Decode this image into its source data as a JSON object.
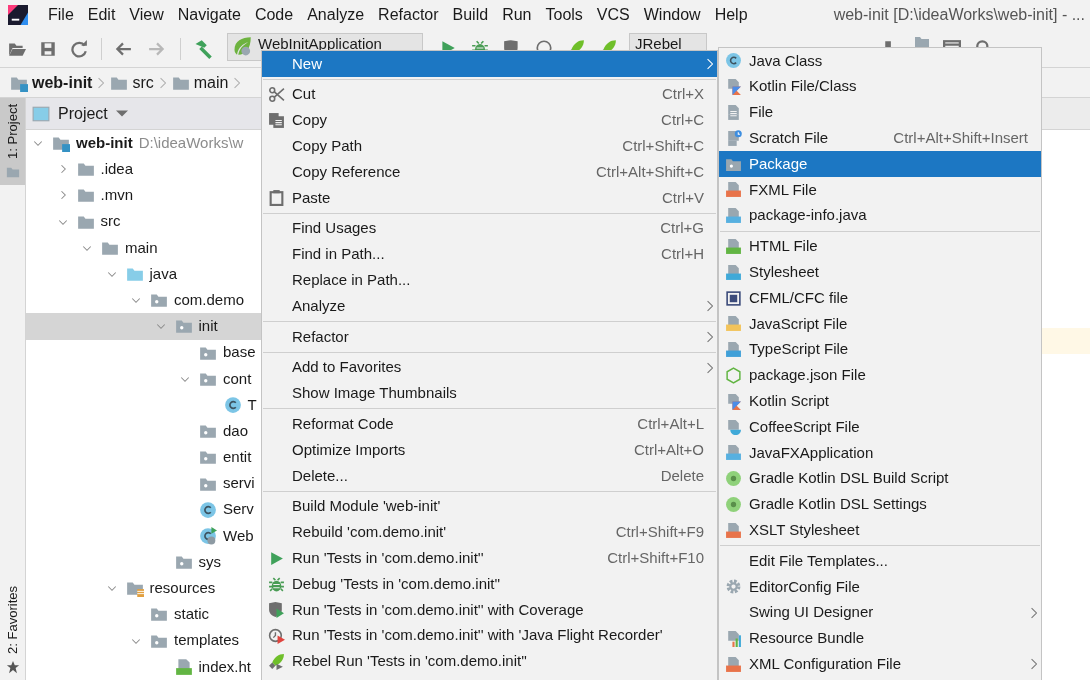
{
  "window": {
    "title": "web-init [D:\\ideaWorks\\web-init] - ..."
  },
  "menu_bar": [
    "File",
    "Edit",
    "View",
    "Navigate",
    "Code",
    "Analyze",
    "Refactor",
    "Build",
    "Run",
    "Tools",
    "VCS",
    "Window",
    "Help"
  ],
  "toolbar": {
    "run_configuration": "WebInitApplication",
    "jrebel_configuration": "JRebel"
  },
  "breadcrumbs": [
    "web-init",
    "src",
    "main"
  ],
  "tool_window_stripe": [
    {
      "label": "1: Project",
      "selected": true
    },
    {
      "label": "2: Favorites",
      "selected": false
    }
  ],
  "project_panel": {
    "title": "Project",
    "tree": [
      {
        "label": "web-init",
        "secondary": "D:\\ideaWorks\\w",
        "kind": "module",
        "expanded": true,
        "selected": false,
        "children": [
          {
            "label": ".idea",
            "kind": "folder",
            "expanded": false,
            "selected": false
          },
          {
            "label": ".mvn",
            "kind": "folder",
            "expanded": false,
            "selected": false
          },
          {
            "label": "src",
            "kind": "folder",
            "expanded": true,
            "selected": false,
            "children": [
              {
                "label": "main",
                "kind": "folder",
                "expanded": true,
                "selected": false,
                "children": [
                  {
                    "label": "java",
                    "kind": "source",
                    "expanded": true,
                    "selected": false,
                    "children": [
                      {
                        "label": "com.demo",
                        "kind": "package",
                        "expanded": true,
                        "selected": false,
                        "children": [
                          {
                            "label": "init",
                            "kind": "package",
                            "expanded": true,
                            "selected": true,
                            "children": [
                              {
                                "label": "base",
                                "kind": "package",
                                "selected": false
                              },
                              {
                                "label": "cont",
                                "kind": "package",
                                "expanded": true,
                                "selected": false,
                                "children": [
                                  {
                                    "label": "T",
                                    "kind": "class",
                                    "selected": false
                                  }
                                ]
                              },
                              {
                                "label": "dao",
                                "kind": "package",
                                "selected": false
                              },
                              {
                                "label": "entit",
                                "kind": "package",
                                "selected": false
                              },
                              {
                                "label": "servi",
                                "kind": "package",
                                "selected": false
                              },
                              {
                                "label": "Serv",
                                "kind": "class",
                                "selected": false
                              },
                              {
                                "label": "Web",
                                "kind": "spring-class",
                                "selected": false
                              }
                            ]
                          },
                          {
                            "label": "sys",
                            "kind": "package",
                            "selected": false
                          }
                        ]
                      }
                    ]
                  },
                  {
                    "label": "resources",
                    "kind": "resources",
                    "expanded": true,
                    "selected": false,
                    "children": [
                      {
                        "label": "static",
                        "kind": "package",
                        "selected": false
                      },
                      {
                        "label": "templates",
                        "kind": "package",
                        "expanded": true,
                        "selected": false,
                        "children": [
                          {
                            "label": "index.ht",
                            "kind": "html",
                            "selected": false
                          }
                        ]
                      }
                    ]
                  }
                ]
              }
            ]
          }
        ]
      }
    ]
  },
  "context_menu": {
    "items": [
      {
        "kind": "plain",
        "label": "New",
        "selected": true,
        "submenu": true
      },
      {
        "kind": "separator"
      },
      {
        "kind": "cut",
        "label": "Cut",
        "shortcut": "Ctrl+X",
        "selected": false
      },
      {
        "kind": "copy",
        "label": "Copy",
        "shortcut": "Ctrl+C",
        "selected": false
      },
      {
        "kind": "plain",
        "label": "Copy Path",
        "shortcut": "Ctrl+Shift+C",
        "selected": false
      },
      {
        "kind": "plain",
        "label": "Copy Reference",
        "shortcut": "Ctrl+Alt+Shift+C",
        "selected": false
      },
      {
        "kind": "paste",
        "label": "Paste",
        "shortcut": "Ctrl+V",
        "selected": false
      },
      {
        "kind": "separator"
      },
      {
        "kind": "plain",
        "label": "Find Usages",
        "shortcut": "Ctrl+G",
        "selected": false
      },
      {
        "kind": "plain",
        "label": "Find in Path...",
        "shortcut": "Ctrl+H",
        "selected": false
      },
      {
        "kind": "plain",
        "label": "Replace in Path...",
        "selected": false
      },
      {
        "kind": "plain",
        "label": "Analyze",
        "submenu": true,
        "selected": false
      },
      {
        "kind": "separator"
      },
      {
        "kind": "plain",
        "label": "Refactor",
        "submenu": true,
        "selected": false
      },
      {
        "kind": "separator"
      },
      {
        "kind": "plain",
        "label": "Add to Favorites",
        "submenu": true,
        "selected": false
      },
      {
        "kind": "plain",
        "label": "Show Image Thumbnails",
        "selected": false
      },
      {
        "kind": "separator"
      },
      {
        "kind": "plain",
        "label": "Reformat Code",
        "shortcut": "Ctrl+Alt+L",
        "selected": false
      },
      {
        "kind": "plain",
        "label": "Optimize Imports",
        "shortcut": "Ctrl+Alt+O",
        "selected": false
      },
      {
        "kind": "plain",
        "label": "Delete...",
        "shortcut": "Delete",
        "selected": false
      },
      {
        "kind": "separator"
      },
      {
        "kind": "plain",
        "label": "Build Module 'web-init'",
        "selected": false
      },
      {
        "kind": "plain",
        "label": "Rebuild 'com.demo.init'",
        "shortcut": "Ctrl+Shift+F9",
        "selected": false
      },
      {
        "kind": "run",
        "label": "Run 'Tests in 'com.demo.init''",
        "shortcut": "Ctrl+Shift+F10",
        "selected": false
      },
      {
        "kind": "debug",
        "label": "Debug 'Tests in 'com.demo.init''",
        "selected": false
      },
      {
        "kind": "coverage",
        "label": "Run 'Tests in 'com.demo.init'' with Coverage",
        "selected": false
      },
      {
        "kind": "profiler",
        "label": "Run 'Tests in 'com.demo.init'' with 'Java Flight Recorder'",
        "selected": false
      },
      {
        "kind": "rebel",
        "label": "Rebel Run 'Tests in 'com.demo.init''",
        "selected": false
      }
    ]
  },
  "new_submenu": {
    "items": [
      {
        "kind": "class",
        "label": "Java Class",
        "selected": false
      },
      {
        "kind": "kotlin",
        "label": "Kotlin File/Class",
        "selected": false
      },
      {
        "kind": "file",
        "label": "File",
        "selected": false
      },
      {
        "kind": "scratch",
        "label": "Scratch File",
        "shortcut": "Ctrl+Alt+Shift+Insert",
        "selected": false
      },
      {
        "kind": "package",
        "label": "Package",
        "selected": true
      },
      {
        "kind": "fxml",
        "label": "FXML File",
        "selected": false
      },
      {
        "kind": "java-file",
        "label": "package-info.java",
        "selected": false
      },
      {
        "kind": "separator"
      },
      {
        "kind": "html",
        "label": "HTML File",
        "selected": false
      },
      {
        "kind": "css",
        "label": "Stylesheet",
        "selected": false
      },
      {
        "kind": "cfml",
        "label": "CFML/CFC file",
        "selected": false
      },
      {
        "kind": "js",
        "label": "JavaScript File",
        "selected": false
      },
      {
        "kind": "ts",
        "label": "TypeScript File",
        "selected": false
      },
      {
        "kind": "nodejs",
        "label": "package.json File",
        "selected": false
      },
      {
        "kind": "kotlin",
        "label": "Kotlin Script",
        "selected": false
      },
      {
        "kind": "coffee",
        "label": "CoffeeScript File",
        "selected": false
      },
      {
        "kind": "java-file",
        "label": "JavaFXApplication",
        "selected": false
      },
      {
        "kind": "gradle",
        "label": "Gradle Kotlin DSL Build Script",
        "selected": false
      },
      {
        "kind": "gradle",
        "label": "Gradle Kotlin DSL Settings",
        "selected": false
      },
      {
        "kind": "fxml",
        "label": "XSLT Stylesheet",
        "selected": false
      },
      {
        "kind": "separator"
      },
      {
        "kind": "plain",
        "label": "Edit File Templates...",
        "selected": false
      },
      {
        "kind": "gear",
        "label": "EditorConfig File",
        "selected": false
      },
      {
        "kind": "plain",
        "label": "Swing UI Designer",
        "submenu": true,
        "selected": false
      },
      {
        "kind": "resource",
        "label": "Resource Bundle",
        "selected": false
      },
      {
        "kind": "fxml",
        "label": "XML Configuration File",
        "submenu": true,
        "selected": false
      }
    ]
  }
}
